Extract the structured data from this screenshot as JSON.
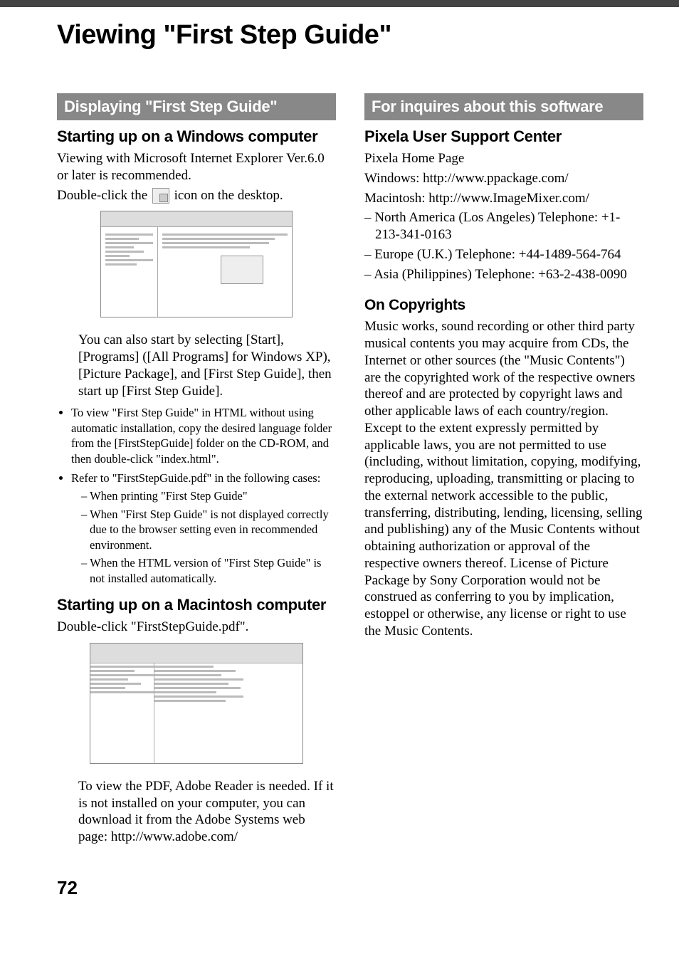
{
  "title": "Viewing \"First Step Guide\"",
  "left": {
    "header": "Displaying \"First Step Guide\"",
    "sub_windows": "Starting up on a Windows computer",
    "p1a": "Viewing with Microsoft Internet Explorer Ver.6.0 or later is recommended.",
    "p1b_pre": "Double-click the ",
    "p1b_post": " icon on the desktop.",
    "p2": "You can also start by selecting [Start], [Programs] ([All Programs] for Windows XP), [Picture Package], and [First Step Guide], then start up [First Step Guide].",
    "bullet1": "To view \"First Step Guide\" in HTML without using automatic installation, copy the desired language folder from the [FirstStepGuide] folder on the CD-ROM, and then double-click \"index.html\".",
    "bullet2": "Refer to \"FirstStepGuide.pdf\" in the following cases:",
    "dash1": "When printing \"First Step Guide\"",
    "dash2": "When \"First Step Guide\" is not displayed correctly due to the browser setting even in recommended environment.",
    "dash3": "When the HTML version of \"First Step Guide\" is not installed automatically.",
    "sub_mac": "Starting up on a Macintosh computer",
    "mac_p": "Double-click \"FirstStepGuide.pdf\".",
    "mac_note": "To view the PDF, Adobe Reader is needed. If it is not installed on your computer, you can download it from the Adobe Systems web page: http://www.adobe.com/"
  },
  "right": {
    "header": "For inquires about this software",
    "sub_support": "Pixela User Support Center",
    "home": "Pixela Home Page",
    "win": "Windows: http://www.ppackage.com/",
    "mac": "Macintosh: http://www.ImageMixer.com/",
    "region1": "North America (Los Angeles) Telephone: +1-213-341-0163",
    "region2": "Europe (U.K.) Telephone: +44-1489-564-764",
    "region3": "Asia (Philippines) Telephone: +63-2-438-0090",
    "sub_copy": "On Copyrights",
    "copy_body": "Music works, sound recording or other third party musical contents you may acquire from CDs, the Internet or other sources (the \"Music Contents\") are the copyrighted work of the respective owners thereof and are protected by copyright laws and other applicable laws of each country/region. Except to the extent expressly permitted by applicable laws, you are not permitted to use (including, without limitation, copying, modifying, reproducing, uploading, transmitting or placing to the external network accessible to the public, transferring, distributing, lending, licensing, selling and publishing) any of the Music Contents without obtaining authorization or approval of the respective owners thereof. License of Picture Package by Sony Corporation would not be construed as conferring to you by implication, estoppel or otherwise, any license or right to use the Music Contents."
  },
  "page": "72"
}
